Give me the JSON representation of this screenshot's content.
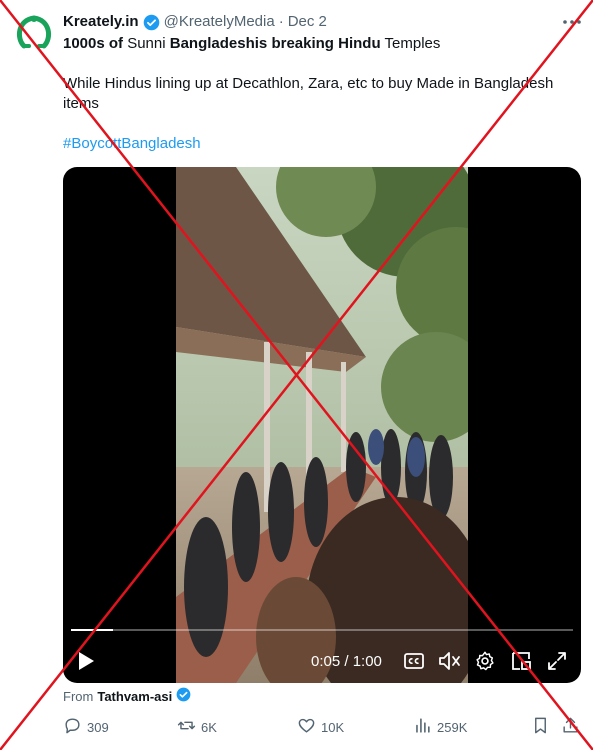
{
  "author": {
    "name": "Kreately.in",
    "handle": "@KreatelyMedia",
    "separator": "·",
    "date": "Dec 2"
  },
  "tweet": {
    "line1_part1": "1000s of",
    "line1_part2": " Sunni ",
    "line1_part3": "Bangladeshis breaking Hindu",
    "line1_part4": " Temples",
    "body": "While Hindus lining up at Decathlon, Zara, etc to buy Made in Bangladesh items",
    "hashtag": "#BoycottBangladesh"
  },
  "video": {
    "time": "0:05 / 1:00",
    "progress": 0.083
  },
  "source": {
    "prefix": "From",
    "name": "Tathvam-asi"
  },
  "actions": {
    "replies": "309",
    "reposts": "6K",
    "likes": "10K",
    "views": "259K"
  },
  "colors": {
    "accent": "#1d9bf0",
    "overlay_cross": "#e0141e",
    "avatar_logo": "#1aa35a"
  },
  "icons": [
    "kreately-logo-icon",
    "verified-badge-icon",
    "more-icon",
    "play-icon",
    "captions-icon",
    "mute-icon",
    "settings-gear-icon",
    "pip-icon",
    "fullscreen-icon",
    "reply-icon",
    "repost-icon",
    "like-icon",
    "views-icon",
    "bookmark-icon",
    "share-icon"
  ]
}
